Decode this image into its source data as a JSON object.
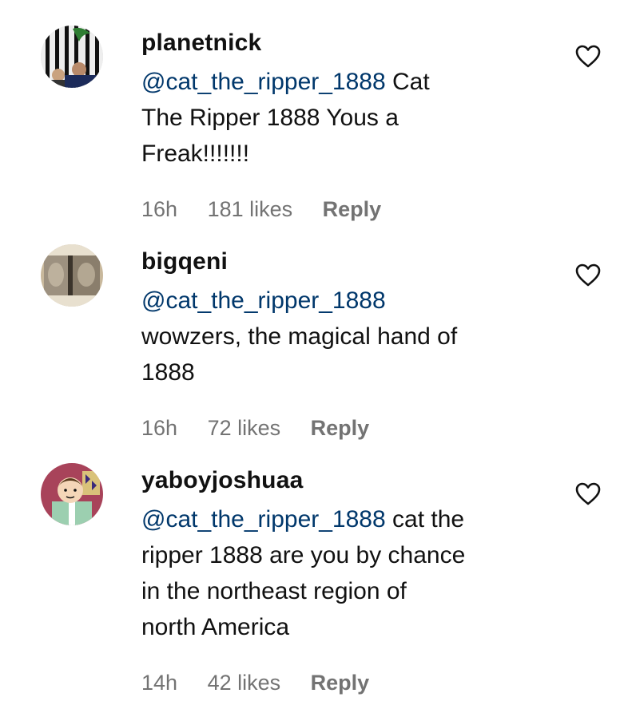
{
  "comments": [
    {
      "username": "planetnick",
      "mention": "@cat_the_ripper_1888",
      "text_line1": " Cat",
      "text_lines": [
        "The Ripper 1888 Yous a",
        "Freak!!!!!!!"
      ],
      "time": "16h",
      "likes": "181 likes",
      "reply": "Reply"
    },
    {
      "username": "bigqeni",
      "mention": "@cat_the_ripper_1888",
      "text_line1": "",
      "text_lines": [
        "wowzers, the magical hand of",
        "1888"
      ],
      "time": "16h",
      "likes": "72 likes",
      "reply": "Reply"
    },
    {
      "username": "yaboyjoshuaa",
      "mention": "@cat_the_ripper_1888",
      "text_line1": " cat the",
      "text_lines": [
        "ripper 1888 are you by chance",
        "in the northeast region of",
        "north America"
      ],
      "time": "14h",
      "likes": "42 likes",
      "reply": "Reply"
    }
  ],
  "colors": {
    "mention": "#00376b",
    "meta": "#737373",
    "text": "#111111"
  },
  "icons": {
    "like": "heart-outline-icon"
  }
}
